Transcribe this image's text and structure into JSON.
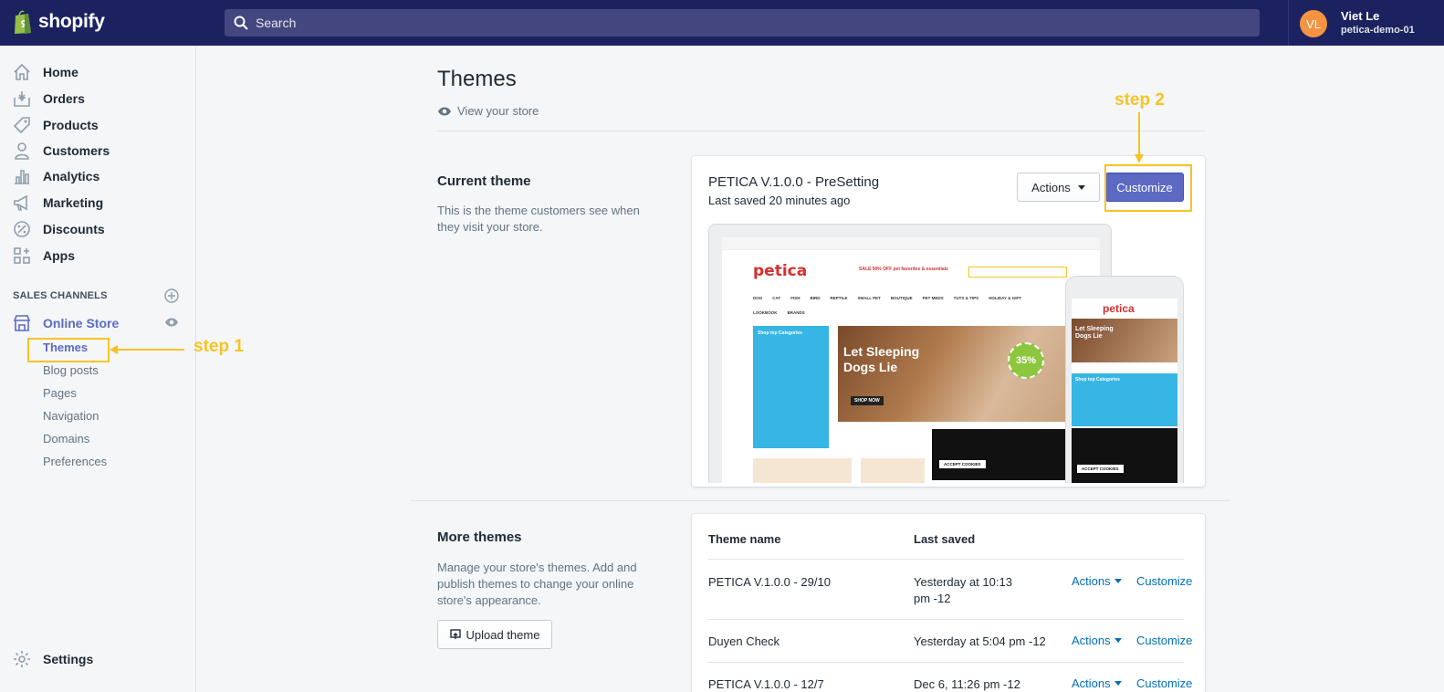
{
  "topbar": {
    "brand": "shopify",
    "search_placeholder": "Search",
    "user_initials": "VL",
    "user_name": "Viet Le",
    "store_name": "petica-demo-01"
  },
  "sidebar": {
    "items": [
      {
        "label": "Home",
        "icon": "home-icon"
      },
      {
        "label": "Orders",
        "icon": "orders-icon"
      },
      {
        "label": "Products",
        "icon": "tag-icon"
      },
      {
        "label": "Customers",
        "icon": "person-icon"
      },
      {
        "label": "Analytics",
        "icon": "bar-chart-icon"
      },
      {
        "label": "Marketing",
        "icon": "megaphone-icon"
      },
      {
        "label": "Discounts",
        "icon": "discount-icon"
      },
      {
        "label": "Apps",
        "icon": "apps-icon"
      }
    ],
    "sales_channels_title": "SALES CHANNELS",
    "online_store": "Online Store",
    "sub_items": [
      "Themes",
      "Blog posts",
      "Pages",
      "Navigation",
      "Domains",
      "Preferences"
    ],
    "settings": "Settings"
  },
  "main": {
    "title": "Themes",
    "view_store": "View your store",
    "current": {
      "heading": "Current theme",
      "description": "This is the theme customers see when they visit your store.",
      "theme_name": "PETICA V.1.0.0 - PreSetting",
      "last_saved": "Last saved 20 minutes ago",
      "actions_label": "Actions",
      "customize_label": "Customize"
    },
    "more": {
      "heading": "More themes",
      "description": "Manage your store's themes. Add and publish themes to change your online store's appearance.",
      "upload_label": "Upload theme",
      "col_name": "Theme name",
      "col_saved": "Last saved",
      "rows": [
        {
          "name": "PETICA V.1.0.0 - 29/10",
          "saved": "Yesterday at 10:13 pm -12",
          "actions": "Actions",
          "customize": "Customize"
        },
        {
          "name": "Duyen Check",
          "saved": "Yesterday at 5:04 pm -12",
          "actions": "Actions",
          "customize": "Customize"
        },
        {
          "name": "PETICA V.1.0.0 - 12/7",
          "saved": "Dec 6, 11:26 pm -12",
          "actions": "Actions",
          "customize": "Customize"
        }
      ]
    }
  },
  "preview": {
    "brand": "petica",
    "sale_text": "SALE 50% OFF pet favorites & essentials",
    "hero_line1": "Let Sleeping",
    "hero_line2": "Dogs Lie",
    "shop_now": "SHOP NOW",
    "discount": "35%",
    "categories_title": "Shop top Categories",
    "menu": [
      "DOG",
      "CAT",
      "FISH",
      "BIRD",
      "REPTILE",
      "SMALL PET",
      "BOUTIQUE",
      "PET MEDS",
      "TUTS & TIPS",
      "HOLIDAY & GIFT",
      "LOOKBOOK",
      "BRANDS"
    ],
    "accept_cookies": "ACCEPT COOKIES",
    "phone_hero": "Let Sleeping Dogs Lie"
  },
  "annotations": {
    "step1": "step 1",
    "step2": "step 2"
  },
  "colors": {
    "topbar": "#1c2260",
    "accent": "#5c6ac4",
    "highlight": "#f7c325",
    "link": "#006fbb"
  }
}
